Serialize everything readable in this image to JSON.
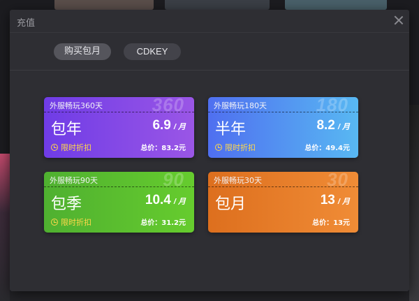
{
  "dialog": {
    "title": "充值"
  },
  "tabs": [
    {
      "label": "购买包月"
    },
    {
      "label": "CDKEY"
    }
  ],
  "plans": [
    {
      "watermark": "360",
      "desc": "外服畅玩360天",
      "name": "包年",
      "price": "6.9",
      "unit": "/ 月",
      "promo": "限时折扣",
      "total": "总价：83.2元"
    },
    {
      "watermark": "180",
      "desc": "外服畅玩180天",
      "name": "半年",
      "price": "8.2",
      "unit": "/ 月",
      "promo": "限时折扣",
      "total": "总价：49.4元"
    },
    {
      "watermark": "90",
      "desc": "外服畅玩90天",
      "name": "包季",
      "price": "10.4",
      "unit": "/ 月",
      "promo": "限时折扣",
      "total": "总价：31.2元"
    },
    {
      "watermark": "30",
      "desc": "外服畅玩30天",
      "name": "包月",
      "price": "13",
      "unit": "/ 月",
      "total": "总价：13元"
    }
  ],
  "colors": {
    "plan_yearly": "#6f3ce6",
    "plan_half": "#4f6ff0",
    "plan_quarter": "#4fb030",
    "plan_monthly": "#dd6f1e",
    "promo": "#ffd84a"
  }
}
